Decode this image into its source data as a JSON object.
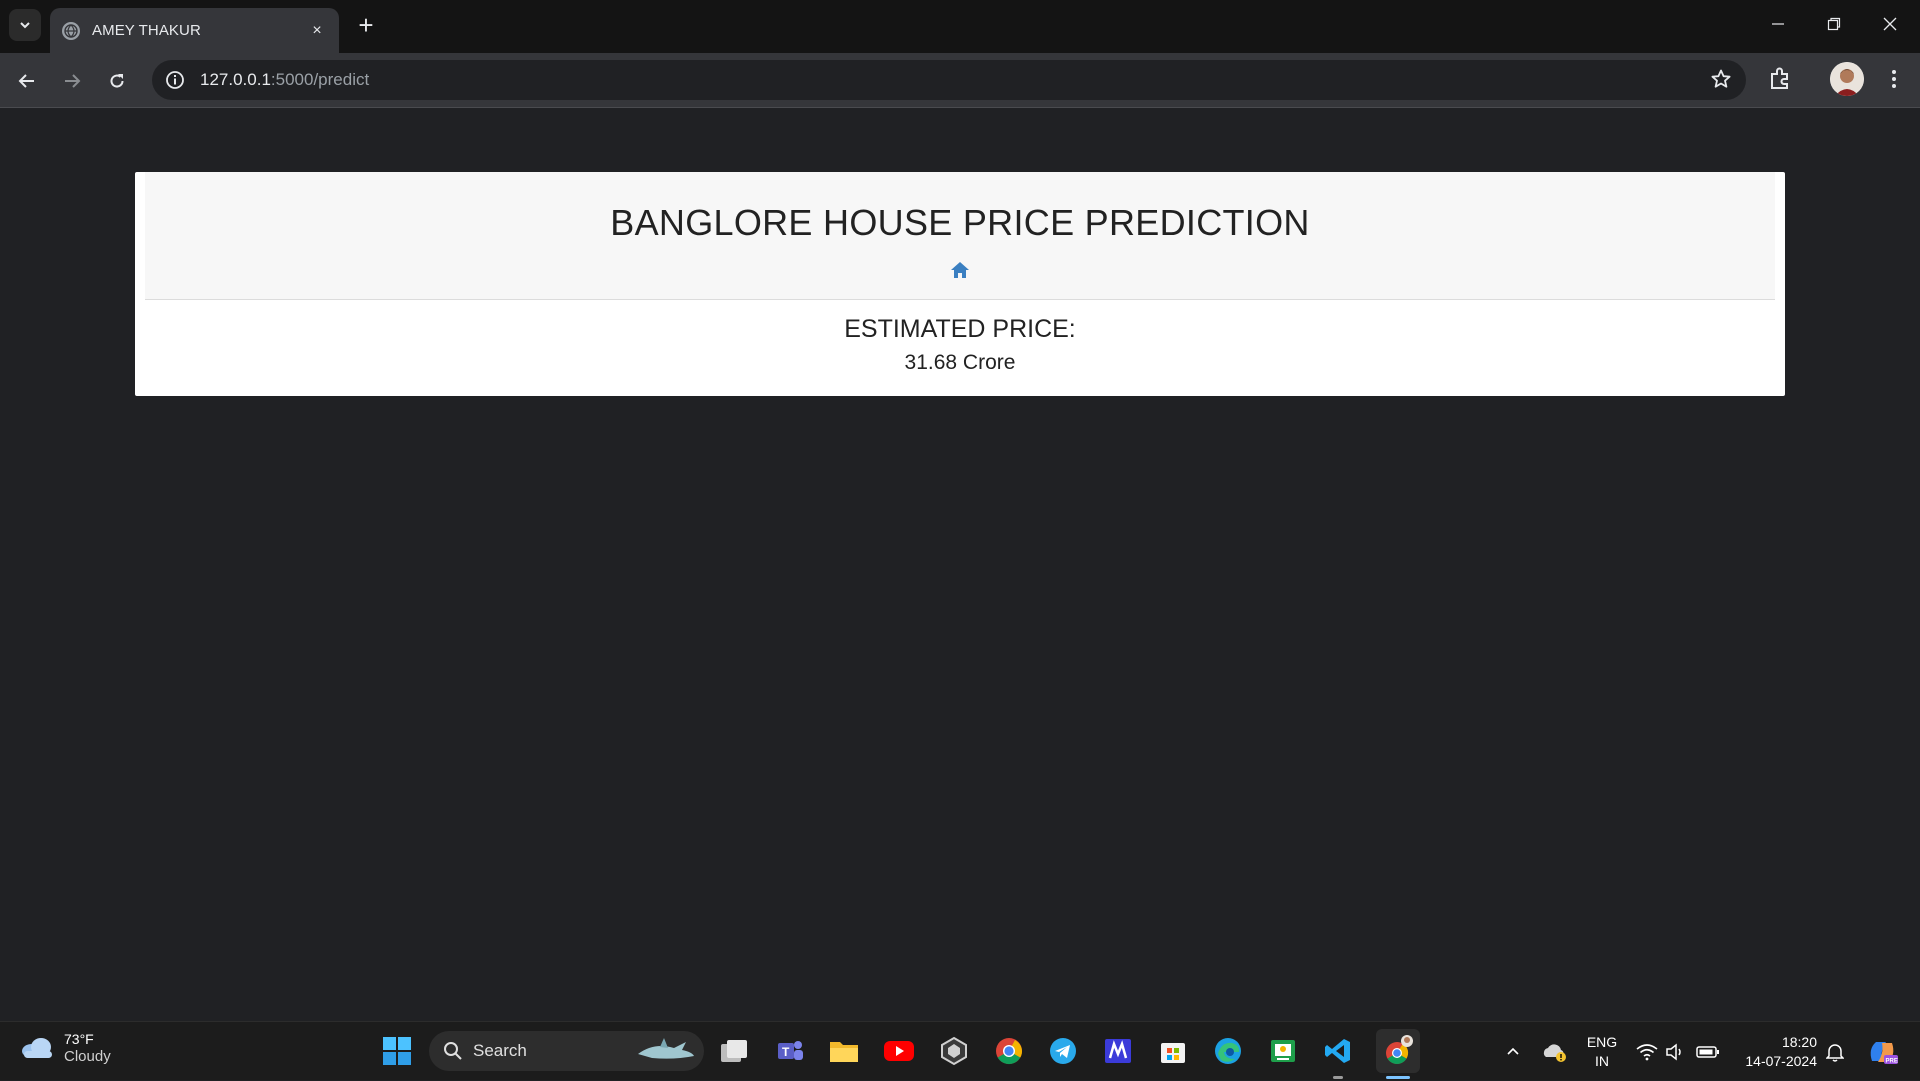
{
  "browser": {
    "tab_title": "AMEY THAKUR",
    "tab_close": "×",
    "new_tab": "+",
    "url_host": "127.0.0.1",
    "url_rest": ":5000/predict"
  },
  "page": {
    "heading": "BANGLORE HOUSE PRICE PREDICTION",
    "result_label": "ESTIMATED PRICE:",
    "result_value": "31.68 Crore",
    "home_icon_color": "#3a7fc1"
  },
  "taskbar": {
    "weather_temp": "73°F",
    "weather_condition": "Cloudy",
    "search_label": "Search",
    "language_line1": "ENG",
    "language_line2": "IN",
    "time": "18:20",
    "date": "14-07-2024",
    "pinned_apps": [
      "windows-start",
      "search",
      "task-view",
      "teams",
      "file-explorer",
      "youtube",
      "app-hexagon",
      "chrome",
      "telegram",
      "app-m",
      "microsoft-store",
      "edge",
      "app-green",
      "vscode",
      "chrome-profile"
    ]
  }
}
